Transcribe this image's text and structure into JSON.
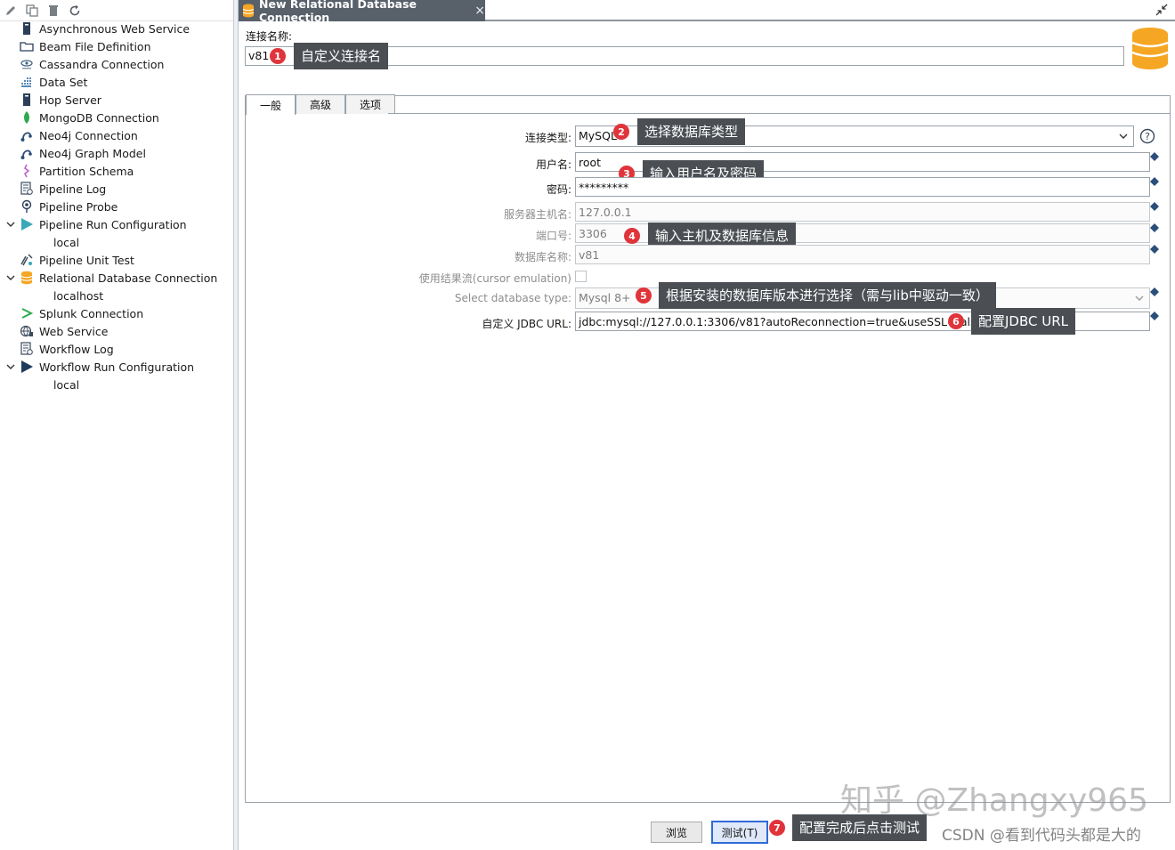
{
  "left_panel": {
    "toolbar_icons": [
      "pencil-icon",
      "duplicate-icon",
      "delete-icon",
      "refresh-icon"
    ],
    "items": [
      {
        "label": "Asynchronous Web Service",
        "icon": "server-icon",
        "expandable": false
      },
      {
        "label": "Beam File Definition",
        "icon": "folder-icon",
        "expandable": false
      },
      {
        "label": "Cassandra Connection",
        "icon": "cassandra-icon",
        "expandable": false
      },
      {
        "label": "Data Set",
        "icon": "dataset-icon",
        "expandable": false
      },
      {
        "label": "Hop Server",
        "icon": "server-icon",
        "expandable": false
      },
      {
        "label": "MongoDB Connection",
        "icon": "mongodb-leaf-icon",
        "expandable": false
      },
      {
        "label": "Neo4j Connection",
        "icon": "neo4j-icon",
        "expandable": false
      },
      {
        "label": "Neo4j Graph Model",
        "icon": "neo4j-icon",
        "expandable": false
      },
      {
        "label": "Partition Schema",
        "icon": "partition-icon",
        "expandable": false
      },
      {
        "label": "Pipeline Log",
        "icon": "log-icon",
        "expandable": false
      },
      {
        "label": "Pipeline Probe",
        "icon": "probe-icon",
        "expandable": false
      },
      {
        "label": "Pipeline Run Configuration",
        "icon": "run-icon",
        "expandable": true
      },
      {
        "label": "local",
        "child": true
      },
      {
        "label": "Pipeline Unit Test",
        "icon": "test-icon",
        "expandable": false
      },
      {
        "label": "Relational Database Connection",
        "icon": "database-icon",
        "expandable": true
      },
      {
        "label": "localhost",
        "child": true
      },
      {
        "label": "Splunk Connection",
        "icon": "splunk-icon",
        "expandable": false
      },
      {
        "label": "Web Service",
        "icon": "web-service-icon",
        "expandable": false
      },
      {
        "label": "Workflow Log",
        "icon": "log-icon",
        "expandable": false
      },
      {
        "label": "Workflow Run Configuration",
        "icon": "run-icon",
        "expandable": true
      },
      {
        "label": "local",
        "child": true
      }
    ]
  },
  "doc_tab": {
    "title": "New Relational Database Connection",
    "close": "×"
  },
  "connection_name": {
    "label": "连接名称:",
    "value": "v81"
  },
  "tabs": [
    "一般",
    "高级",
    "选项"
  ],
  "fields": {
    "type": {
      "label": "连接类型:",
      "value": "MySQL"
    },
    "username": {
      "label": "用户名:",
      "value": "root"
    },
    "password": {
      "label": "密码:",
      "value": "*********"
    },
    "host": {
      "label": "服务器主机名:",
      "value": "127.0.0.1"
    },
    "port": {
      "label": "端口号:",
      "value": "3306"
    },
    "database": {
      "label": "数据库名称:",
      "value": "v81"
    },
    "cursor": {
      "label": "使用结果流(cursor emulation)"
    },
    "db_type": {
      "label": "Select database type:",
      "value": "Mysql 8+"
    },
    "jdbc": {
      "label": "自定义 JDBC URL:",
      "value": "jdbc:mysql://127.0.0.1:3306/v81?autoReconnection=true&useSSL=false"
    }
  },
  "callouts": {
    "c1": {
      "num": "1",
      "text": "自定义连接名"
    },
    "c2": {
      "num": "2",
      "text": "选择数据库类型"
    },
    "c3": {
      "num": "3",
      "text": "输入用户名及密码"
    },
    "c4": {
      "num": "4",
      "text": "输入主机及数据库信息"
    },
    "c5": {
      "num": "5",
      "text": "根据安装的数据库版本进行选择（需与lib中驱动一致）"
    },
    "c6": {
      "num": "6",
      "text": "配置JDBC URL"
    },
    "c7": {
      "num": "7",
      "text": "配置完成后点击测试"
    }
  },
  "buttons": {
    "browse": "浏览",
    "test": "测试(T)"
  },
  "watermarks": {
    "zhihu": "知乎 @Zhangxy965",
    "csdn": "CSDN @看到代码头都是大的"
  },
  "colors": {
    "tab_bg": "#58606a",
    "callout_bg": "#4b4f54",
    "badge": "#e0343b",
    "db_orange": "#f5a623"
  }
}
